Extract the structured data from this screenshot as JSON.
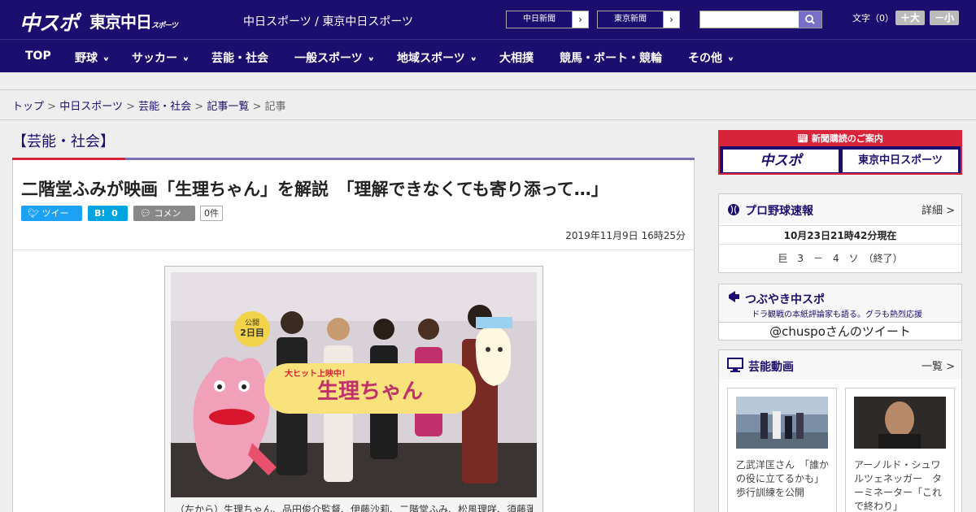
{
  "header": {
    "logo_main": "中スポ",
    "logo_sub": "東京中日",
    "logo_sub_small": "スポーツ",
    "site_name": "中日スポーツ / 東京中日スポーツ",
    "paper_buttons": [
      "中日新聞",
      "東京新聞"
    ],
    "font_label": "文字（0）",
    "font_bigger": "＋大",
    "font_smaller": "－小"
  },
  "nav": {
    "items": [
      {
        "label": "TOP",
        "has_menu": false
      },
      {
        "label": "野球",
        "has_menu": true
      },
      {
        "label": "サッカー",
        "has_menu": true
      },
      {
        "label": "芸能・社会",
        "has_menu": false
      },
      {
        "label": "一般スポーツ",
        "has_menu": true
      },
      {
        "label": "地域スポーツ",
        "has_menu": true
      },
      {
        "label": "大相撲",
        "has_menu": false
      },
      {
        "label": "競馬・ボート・競輪",
        "has_menu": false
      },
      {
        "label": "その他",
        "has_menu": true
      }
    ]
  },
  "breadcrumb": {
    "items": [
      "トップ",
      "中日スポーツ",
      "芸能・社会",
      "記事一覧"
    ],
    "current": "記事",
    "separator": ">"
  },
  "article": {
    "category": "【芸能・社会】",
    "title": "二階堂ふみが映画「生理ちゃん」を解説　「理解できなくても寄り添って…」",
    "tweet_label": "ツイート",
    "hatena_label": "B!",
    "hatena_count": "0",
    "comment_label": "コメント",
    "comment_count": "0件",
    "date": "2019年11月9日 16時25分",
    "caption": "（左から）生理ちゃん、品田俊介監督、伊藤沙莉、二階堂ふみ、松風理咲、須藤蓮",
    "photo_sign_small": "公開",
    "photo_sign_day": "2日目",
    "photo_banner": "生理ちゃん",
    "photo_banner_tag": "大ヒット上映中！"
  },
  "sidebar": {
    "subscribe_title": "新聞購読のご案内",
    "subscribe_buttons": [
      "中スポ",
      "東京中日スポーツ"
    ],
    "baseball": {
      "title": "プロ野球速報",
      "more": "詳細 >",
      "time": "10月23日21時42分現在",
      "score": "巨　3　－　4　ソ　（終了）"
    },
    "tsubuyaki": {
      "title": "つぶやき中スポ",
      "desc": "ドラ観戦の本紙評論家も語る。グラも熱烈応援",
      "timeline": "@chuspoさんのツイート"
    },
    "videos": {
      "title": "芸能動画",
      "more": "一覧 >",
      "items": [
        {
          "text": "乙武洋匡さん　「誰かの役に立てるかも」歩行訓練を公開"
        },
        {
          "text": "アーノルド・シュワルツェネッガー　ターミネーター「これで終わり」"
        }
      ]
    }
  },
  "colors": {
    "brand_navy": "#1b0e6e",
    "accent_red": "#d8243a",
    "twitter": "#1da1f2",
    "hatena": "#00a4de"
  }
}
